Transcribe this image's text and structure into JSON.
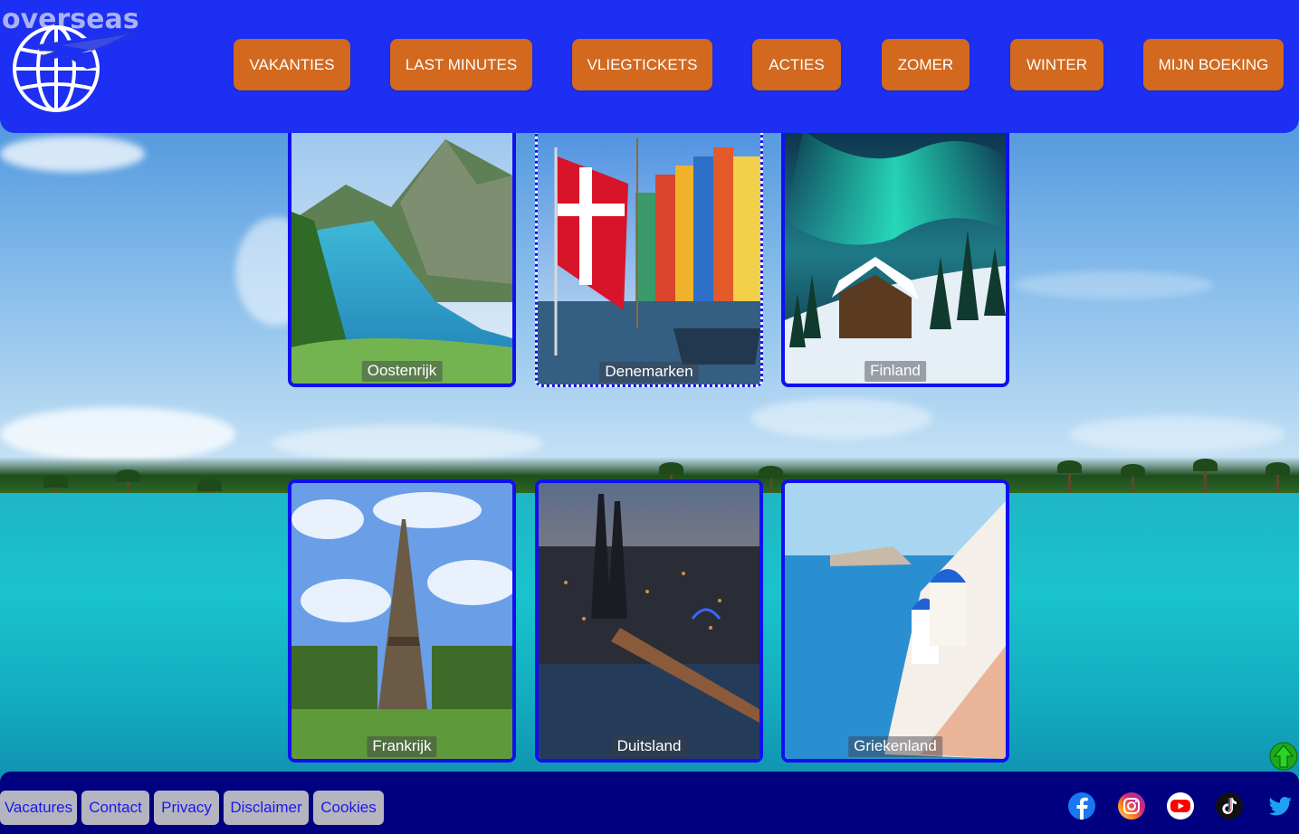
{
  "header": {
    "brand": "overseas",
    "nav": [
      "VAKANTIES",
      "LAST MINUTES",
      "VLIEGTICKETS",
      "ACTIES",
      "ZOMER",
      "WINTER",
      "MIJN BOEKING"
    ]
  },
  "destinations": [
    "Oostenrijk",
    "Denemarken",
    "Finland",
    "Frankrijk",
    "Duitsland",
    "Griekenland"
  ],
  "footer": {
    "links": [
      "Vacatures",
      "Contact",
      "Privacy",
      "Disclaimer",
      "Cookies"
    ],
    "social_icons": [
      "facebook-icon",
      "instagram-icon",
      "youtube-icon",
      "tiktok-icon",
      "twitter-icon"
    ]
  },
  "colors": {
    "header_bg": "#1c2ff2",
    "nav_button": "#d2691e",
    "card_border": "#1010ee",
    "footer_bg": "#000080",
    "footer_link_bg": "#b5b5c0",
    "footer_link_text": "#1818e8"
  },
  "icons": {
    "logo": "globe-airplane-icon",
    "scroll_top": "arrow-up-icon"
  }
}
